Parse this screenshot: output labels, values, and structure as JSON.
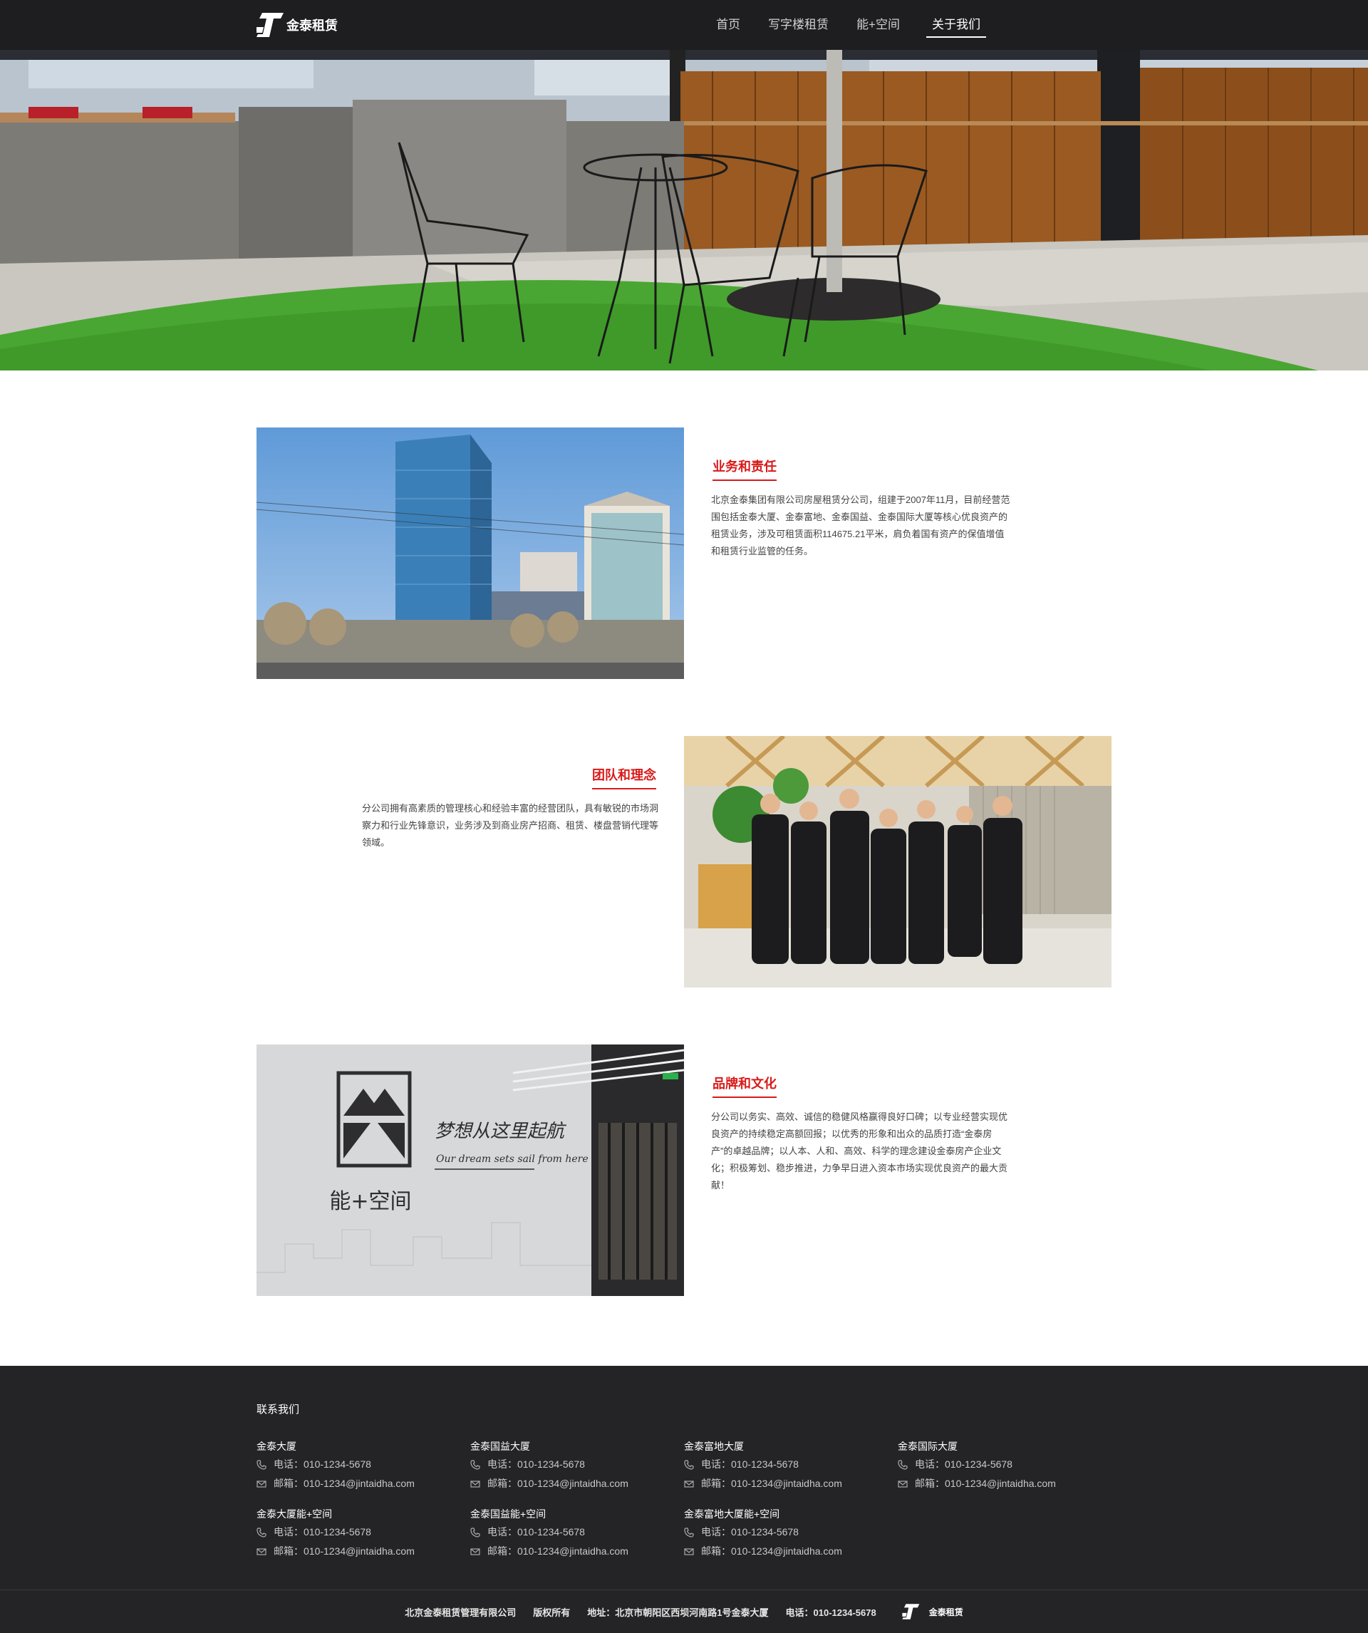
{
  "header": {
    "logo_text": "金泰租赁",
    "nav": [
      {
        "label": "首页",
        "active": false
      },
      {
        "label": "写字楼租赁",
        "active": false
      },
      {
        "label": "能+空间",
        "active": false
      },
      {
        "label": "关于我们",
        "active": true
      }
    ]
  },
  "sections": [
    {
      "title": "业务和责任",
      "text": "北京金泰集团有限公司房屋租赁分公司，组建于2007年11月，目前经营范围包括金泰大厦、金泰富地、金泰国益、金泰国际大厦等核心优良资产的租赁业务，涉及可租赁面积114675.21平米，肩负着国有资产的保值增值和租赁行业监管的任务。"
    },
    {
      "title": "团队和理念",
      "text": "分公司拥有高素质的管理核心和经验丰富的经营团队，具有敏锐的市场洞察力和行业先锋意识，业务涉及到商业房产招商、租赁、楼盘营销代理等领域。"
    },
    {
      "title": "品牌和文化",
      "text": "分公司以务实、高效、诚信的稳健风格赢得良好口碑；以专业经营实现优良资产的持续稳定高额回报；以优秀的形象和出众的品质打造“金泰房产”的卓越品牌；以人本、人和、高效、科学的理念建设金泰房产企业文化；积极筹划、稳步推进，力争早日进入资本市场实现优良资产的最大贡献！",
      "wall_sign": "能+空间",
      "wall_slogan": "梦想从这里起航",
      "wall_slogan_en": "Our dream sets sail from here"
    }
  ],
  "footer": {
    "heading": "联系我们",
    "contacts": [
      {
        "name": "金泰大厦",
        "phone": "电话：010-1234-5678",
        "email": "邮箱：010-1234@jintaidha.com"
      },
      {
        "name": "金泰国益大厦",
        "phone": "电话：010-1234-5678",
        "email": "邮箱：010-1234@jintaidha.com"
      },
      {
        "name": "金泰富地大厦",
        "phone": "电话：010-1234-5678",
        "email": "邮箱：010-1234@jintaidha.com"
      },
      {
        "name": "金泰国际大厦",
        "phone": "电话：010-1234-5678",
        "email": "邮箱：010-1234@jintaidha.com"
      },
      {
        "name": "金泰大厦能+空间",
        "phone": "电话：010-1234-5678",
        "email": "邮箱：010-1234@jintaidha.com"
      },
      {
        "name": "金泰国益能+空间",
        "phone": "电话：010-1234-5678",
        "email": "邮箱：010-1234@jintaidha.com"
      },
      {
        "name": "金泰富地大厦能+空间",
        "phone": "电话：010-1234-5678",
        "email": "邮箱：010-1234@jintaidha.com"
      }
    ],
    "company": "北京金泰租赁管理有限公司",
    "copyright": "版权所有",
    "address": "地址：北京市朝阳区西坝河南路1号金泰大厦",
    "phone": "电话：010-1234-5678",
    "logo_text": "金泰租赁"
  },
  "colors": {
    "header_bg": "#1e1e20",
    "footer_bg": "#242427",
    "accent_red": "#d91a1a"
  }
}
